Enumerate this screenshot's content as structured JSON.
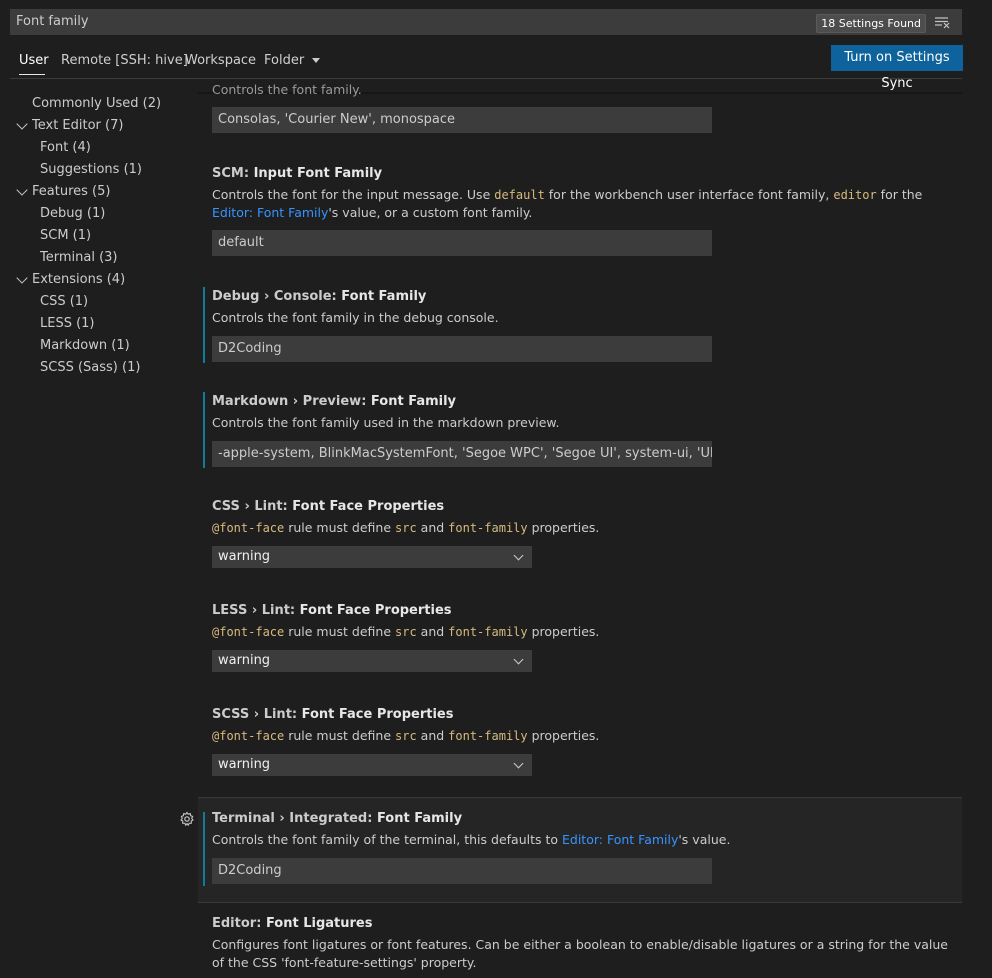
{
  "search": {
    "value": "Font family",
    "count": "18 Settings Found"
  },
  "tabs": [
    {
      "label": "User"
    },
    {
      "label": "Remote [SSH: hive]"
    },
    {
      "label": "Workspace"
    },
    {
      "label": "Folder"
    }
  ],
  "sync_button": "Turn on Settings Sync",
  "toc": {
    "commonly_used": "Commonly Used (2)",
    "text_editor": "Text Editor (7)",
    "font": "Font (4)",
    "suggestions": "Suggestions (1)",
    "features": "Features (5)",
    "debug": "Debug (1)",
    "scm": "SCM (1)",
    "terminal": "Terminal (3)",
    "extensions": "Extensions (4)",
    "css": "CSS (1)",
    "less": "LESS (1)",
    "markdown": "Markdown (1)",
    "scss": "SCSS (Sass) (1)"
  },
  "settings": {
    "editor_font_family": {
      "desc_partial": "Controls the font family.",
      "value": "Consolas, 'Courier New', monospace"
    },
    "scm_input": {
      "category": "SCM: ",
      "key": "Input Font Family",
      "desc_1": "Controls the font for the input message. Use ",
      "code_1": "default",
      "desc_2": " for the workbench user interface font family, ",
      "code_2": "editor",
      "desc_3": " for the ",
      "link": "Editor: Font Family",
      "desc_4": "'s value, or a custom font family.",
      "value": "default"
    },
    "debug_console": {
      "category": "Debug › Console: ",
      "key": "Font Family",
      "desc": "Controls the font family in the debug console.",
      "value": "D2Coding"
    },
    "markdown_preview": {
      "category": "Markdown › Preview: ",
      "key": "Font Family",
      "desc": "Controls the font family used in the markdown preview.",
      "value": "-apple-system, BlinkMacSystemFont, 'Segoe WPC', 'Segoe UI', system-ui, 'Ubuntu', '..."
    },
    "css_lint": {
      "category": "CSS › Lint: ",
      "key": "Font Face Properties",
      "code_1": "@font-face",
      "desc_1": " rule must define ",
      "code_2": "src",
      "desc_2": " and ",
      "code_3": "font-family",
      "desc_3": " properties.",
      "value": "warning"
    },
    "less_lint": {
      "category": "LESS › Lint: ",
      "key": "Font Face Properties",
      "code_1": "@font-face",
      "desc_1": " rule must define ",
      "code_2": "src",
      "desc_2": " and ",
      "code_3": "font-family",
      "desc_3": " properties.",
      "value": "warning"
    },
    "scss_lint": {
      "category": "SCSS › Lint: ",
      "key": "Font Face Properties",
      "code_1": "@font-face",
      "desc_1": " rule must define ",
      "code_2": "src",
      "desc_2": " and ",
      "code_3": "font-family",
      "desc_3": " properties.",
      "value": "warning"
    },
    "terminal_font": {
      "category": "Terminal › Integrated: ",
      "key": "Font Family",
      "desc_1": "Controls the font family of the terminal, this defaults to ",
      "link": "Editor: Font Family",
      "desc_2": "'s value.",
      "value": "D2Coding"
    },
    "font_ligatures": {
      "category": "Editor: ",
      "key": "Font Ligatures",
      "desc": "Configures font ligatures or font features. Can be either a boolean to enable/disable ligatures or a string for the value of the CSS 'font-feature-settings' property."
    }
  }
}
